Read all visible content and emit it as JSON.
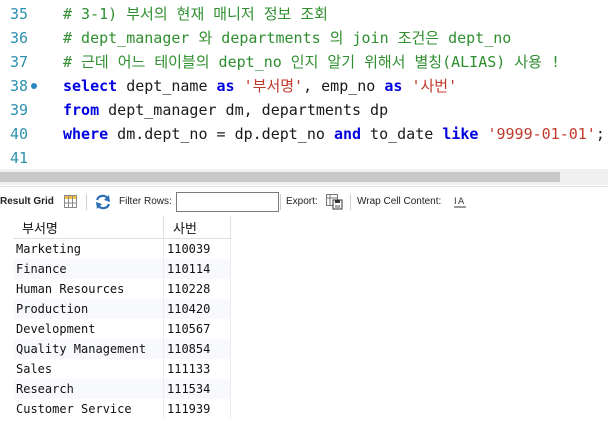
{
  "editor": {
    "lines": [
      {
        "num": "35",
        "parts": [
          {
            "t": "cm",
            "v": "# 3-1) 부서의 현재 매니저 정보 조회"
          }
        ]
      },
      {
        "num": "36",
        "parts": [
          {
            "t": "cm",
            "v": "# dept_manager 와 departments 의 join 조건은 dept_no"
          }
        ]
      },
      {
        "num": "37",
        "parts": [
          {
            "t": "cm",
            "v": "# 근데 어느 테이블의 dept_no 인지 알기 위해서 별칭(ALIAS) 사용 !"
          }
        ]
      },
      {
        "num": "38",
        "breakpoint": true,
        "parts": [
          {
            "t": "kw",
            "v": "select"
          },
          {
            "t": "id",
            "v": " dept_name "
          },
          {
            "t": "kw",
            "v": "as"
          },
          {
            "t": "id",
            "v": " "
          },
          {
            "t": "st",
            "v": "'부서명'"
          },
          {
            "t": "id",
            "v": ", emp_no "
          },
          {
            "t": "kw",
            "v": "as"
          },
          {
            "t": "id",
            "v": " "
          },
          {
            "t": "st",
            "v": "'사번'"
          }
        ]
      },
      {
        "num": "39",
        "parts": [
          {
            "t": "kw",
            "v": "from"
          },
          {
            "t": "id",
            "v": " dept_manager dm, departments dp"
          }
        ]
      },
      {
        "num": "40",
        "parts": [
          {
            "t": "kw",
            "v": "where"
          },
          {
            "t": "id",
            "v": " dm.dept_no = dp.dept_no "
          },
          {
            "t": "kw",
            "v": "and"
          },
          {
            "t": "id",
            "v": " to_date "
          },
          {
            "t": "kw",
            "v": "like"
          },
          {
            "t": "id",
            "v": " "
          },
          {
            "t": "st",
            "v": "'9999-01-01'"
          },
          {
            "t": "id",
            "v": ";"
          }
        ]
      },
      {
        "num": "41",
        "parts": []
      }
    ]
  },
  "toolbar": {
    "result_grid_label": "Result Grid",
    "filter_rows_label": "Filter Rows:",
    "filter_value": "",
    "export_label": "Export:",
    "wrap_label": "Wrap Cell Content:"
  },
  "grid": {
    "columns": [
      "부서명",
      "사번"
    ],
    "rows": [
      [
        "Marketing",
        "110039"
      ],
      [
        "Finance",
        "110114"
      ],
      [
        "Human Resources",
        "110228"
      ],
      [
        "Production",
        "110420"
      ],
      [
        "Development",
        "110567"
      ],
      [
        "Quality Management",
        "110854"
      ],
      [
        "Sales",
        "111133"
      ],
      [
        "Research",
        "111534"
      ],
      [
        "Customer Service",
        "111939"
      ]
    ]
  },
  "colors": {
    "comment": "#2f8f2f",
    "keyword": "#0000e0",
    "string": "#c0392b",
    "line_number": "#2b91af"
  }
}
